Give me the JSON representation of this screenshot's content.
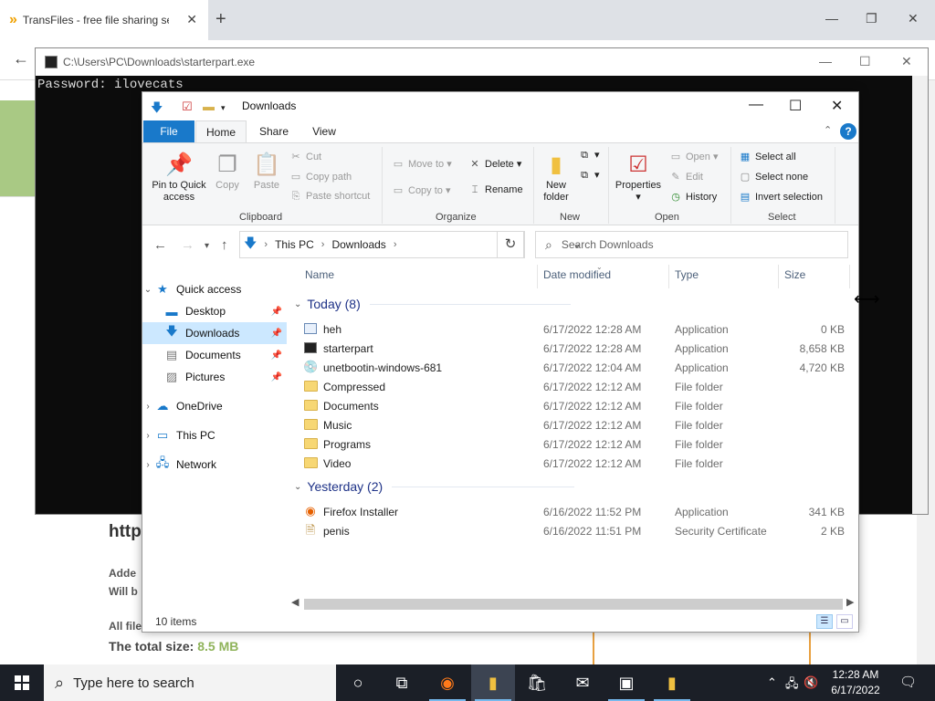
{
  "browser": {
    "tab_title": "TransFiles - free file sharing ser",
    "tab_icon": "chevron-logo-icon",
    "page_url_fragment": "http",
    "page_lines": [
      "Adde",
      "Will b",
      "All file"
    ],
    "total_size_label": "The total size:",
    "total_size_value": "8.5 MB"
  },
  "console": {
    "title": "C:\\Users\\PC\\Downloads\\starterpart.exe",
    "output": "Password: ilovecats"
  },
  "explorer": {
    "title": "Downloads",
    "ribbon_tabs": [
      "File",
      "Home",
      "Share",
      "View"
    ],
    "ribbon": {
      "clipboard": {
        "label": "Clipboard",
        "pin_quick": "Pin to Quick access",
        "copy": "Copy",
        "paste": "Paste",
        "cut": "Cut",
        "copy_path": "Copy path",
        "paste_shortcut": "Paste shortcut"
      },
      "organize": {
        "label": "Organize",
        "move_to": "Move to",
        "copy_to": "Copy to",
        "delete": "Delete",
        "rename": "Rename"
      },
      "new": {
        "label": "New",
        "new_folder": "New folder"
      },
      "open": {
        "label": "Open",
        "properties": "Properties",
        "open": "Open",
        "edit": "Edit",
        "history": "History"
      },
      "select": {
        "label": "Select",
        "select_all": "Select all",
        "select_none": "Select none",
        "invert": "Invert selection"
      }
    },
    "address": {
      "segments": [
        "This PC",
        "Downloads"
      ],
      "search_placeholder": "Search Downloads"
    },
    "nav": {
      "quick_access": "Quick access",
      "desktop": "Desktop",
      "downloads": "Downloads",
      "documents": "Documents",
      "pictures": "Pictures",
      "onedrive": "OneDrive",
      "this_pc": "This PC",
      "network": "Network"
    },
    "columns": [
      "Name",
      "Date modified",
      "Type",
      "Size"
    ],
    "groups": [
      {
        "label": "Today (8)",
        "files": [
          {
            "name": "heh",
            "date": "6/17/2022 12:28 AM",
            "type": "Application",
            "size": "0 KB",
            "icon": "app"
          },
          {
            "name": "starterpart",
            "date": "6/17/2022 12:28 AM",
            "type": "Application",
            "size": "8,658 KB",
            "icon": "app-dark"
          },
          {
            "name": "unetbootin-windows-681",
            "date": "6/17/2022 12:04 AM",
            "type": "Application",
            "size": "4,720 KB",
            "icon": "app-disk"
          },
          {
            "name": "Compressed",
            "date": "6/17/2022 12:12 AM",
            "type": "File folder",
            "size": "",
            "icon": "folder"
          },
          {
            "name": "Documents",
            "date": "6/17/2022 12:12 AM",
            "type": "File folder",
            "size": "",
            "icon": "folder"
          },
          {
            "name": "Music",
            "date": "6/17/2022 12:12 AM",
            "type": "File folder",
            "size": "",
            "icon": "folder"
          },
          {
            "name": "Programs",
            "date": "6/17/2022 12:12 AM",
            "type": "File folder",
            "size": "",
            "icon": "folder"
          },
          {
            "name": "Video",
            "date": "6/17/2022 12:12 AM",
            "type": "File folder",
            "size": "",
            "icon": "folder"
          }
        ]
      },
      {
        "label": "Yesterday (2)",
        "files": [
          {
            "name": "Firefox Installer",
            "date": "6/16/2022 11:52 PM",
            "type": "Application",
            "size": "341 KB",
            "icon": "firefox"
          },
          {
            "name": "penis",
            "date": "6/16/2022 11:51 PM",
            "type": "Security Certificate",
            "size": "2 KB",
            "icon": "cert"
          }
        ]
      }
    ],
    "status": "10 items"
  },
  "taskbar": {
    "search_placeholder": "Type here to search",
    "time": "12:28 AM",
    "date": "6/17/2022"
  },
  "colors": {
    "accent": "#1979ca",
    "selection": "#cce8ff",
    "taskbar": "#1b1f27"
  }
}
